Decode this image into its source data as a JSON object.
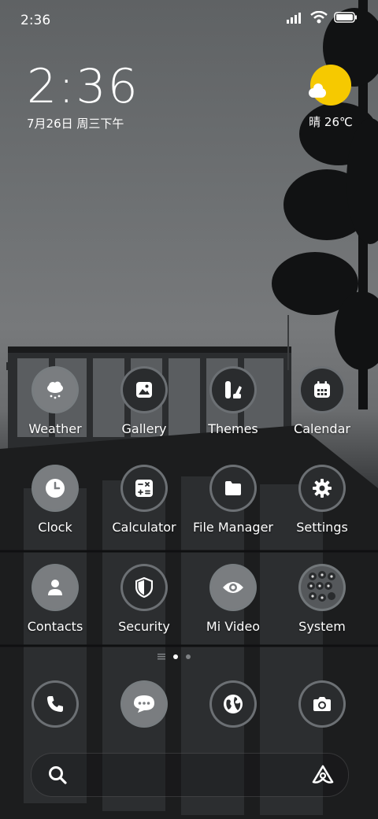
{
  "status_bar": {
    "time": "2:36"
  },
  "clock_widget": {
    "time": "2:36",
    "date": "7月26日 周三下午"
  },
  "weather_widget": {
    "condition": "晴",
    "temperature": "26℃"
  },
  "apps": [
    {
      "label": "Weather",
      "icon": "weather-icon"
    },
    {
      "label": "Gallery",
      "icon": "gallery-icon"
    },
    {
      "label": "Themes",
      "icon": "themes-icon"
    },
    {
      "label": "Calendar",
      "icon": "calendar-icon"
    },
    {
      "label": "Clock",
      "icon": "clock-icon"
    },
    {
      "label": "Calculator",
      "icon": "calculator-icon"
    },
    {
      "label": "File Manager",
      "icon": "folder-icon"
    },
    {
      "label": "Settings",
      "icon": "gear-icon"
    },
    {
      "label": "Contacts",
      "icon": "person-icon"
    },
    {
      "label": "Security",
      "icon": "shield-icon"
    },
    {
      "label": "Mi Video",
      "icon": "eye-icon"
    },
    {
      "label": "System",
      "icon": "folder-grid-icon"
    }
  ],
  "dock": [
    {
      "icon": "phone-icon"
    },
    {
      "icon": "messages-icon"
    },
    {
      "icon": "browser-globe-icon"
    },
    {
      "icon": "camera-icon"
    }
  ],
  "page_indicator": {
    "pages": 2,
    "current": 1
  },
  "colors": {
    "sun": "#f6c900",
    "icon_light": "#7a7d80",
    "icon_dark": "#2a2c2e"
  }
}
